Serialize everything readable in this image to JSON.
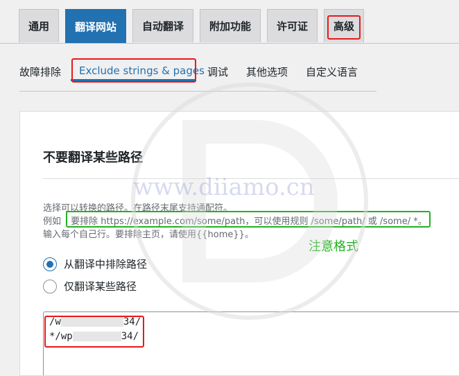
{
  "top_tabs": [
    {
      "label": "通用"
    },
    {
      "label": "翻译网站"
    },
    {
      "label": "自动翻译"
    },
    {
      "label": "附加功能"
    },
    {
      "label": "许可证"
    },
    {
      "label": "高级"
    }
  ],
  "subnav": [
    {
      "label": "故障排除"
    },
    {
      "label": "Exclude strings & pages"
    },
    {
      "label": "调试"
    },
    {
      "label": "其他选项"
    },
    {
      "label": "自定义语言"
    }
  ],
  "card": {
    "title": "不要翻译某些路径",
    "desc_line1": "选择可以转换的路径。在路径末尾支持通配符。",
    "desc_line2_prefix": "例如",
    "desc_line2_example": "要排除 https://example.com/some/path，可以使用规则 /some/path/ 或 /some/ *。",
    "desc_line3": "输入每个自己行。要排除主页，请使用{{home}}。",
    "note": "注意格式",
    "radio_exclude": "从翻译中排除路径",
    "radio_only": "仅翻译某些路径",
    "path1_start": "/w",
    "path1_end": "34/",
    "path2_start": "*/wp",
    "path2_end": "34/"
  },
  "watermark": "www.diiamo.cn",
  "colors": {
    "accent": "#2271b1",
    "highlight_red": "#e6191a",
    "highlight_green": "#22b21f"
  }
}
